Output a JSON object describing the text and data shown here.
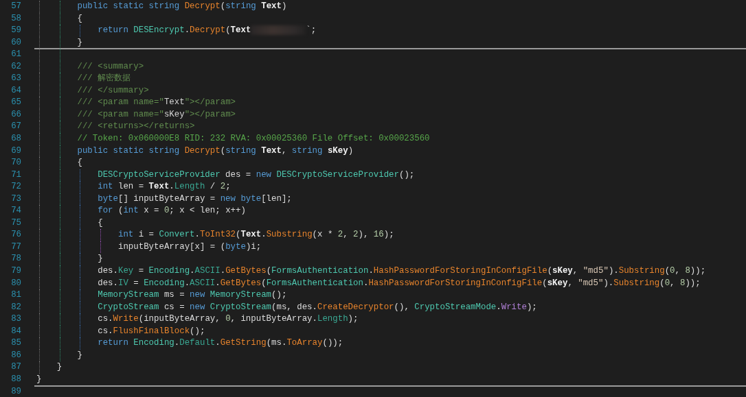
{
  "editor": {
    "lines": [
      {
        "children": [
          {
            "children": [
              {
                "number": "57",
                "separator": false,
                "tokens": [
                  {
                    "kind": "kw",
                    "text": "public static string "
                  },
                  {
                    "kind": "method",
                    "text": "Decrypt"
                  },
                  {
                    "kind": "plain",
                    "text": "("
                  },
                  {
                    "kind": "kw",
                    "text": "string "
                  },
                  {
                    "kind": "param",
                    "text": "Text"
                  },
                  {
                    "kind": "plain",
                    "text": ")"
                  }
                ]
              },
              {
                "number": "58",
                "separator": false,
                "tokens": [
                  {
                    "kind": "plain",
                    "text": "{"
                  }
                ],
                "children": [
                  {
                    "number": "59",
                    "separator": false,
                    "tokens": [
                      {
                        "kind": "kw",
                        "text": "return "
                      },
                      {
                        "kind": "type",
                        "text": "DESEncrypt"
                      },
                      {
                        "kind": "plain",
                        "text": "."
                      },
                      {
                        "kind": "method",
                        "text": "Decrypt"
                      },
                      {
                        "kind": "plain",
                        "text": "("
                      },
                      {
                        "kind": "param",
                        "text": "Text"
                      },
                      {
                        "kind": "redacted"
                      },
                      {
                        "kind": "plain",
                        "text": "`;"
                      }
                    ]
                  }
                ]
              },
              {
                "number": "60",
                "separator": true,
                "tokens": [
                  {
                    "kind": "plain",
                    "text": "}"
                  }
                ]
              },
              {
                "number": "61",
                "separator": false
              },
              {
                "number": "62",
                "separator": false,
                "tokens": [
                  {
                    "kind": "doc",
                    "text": "/// <summary>"
                  }
                ]
              },
              {
                "number": "63",
                "separator": false,
                "tokens": [
                  {
                    "kind": "doc",
                    "text": "/// 解密数据"
                  }
                ]
              },
              {
                "number": "64",
                "separator": false,
                "tokens": [
                  {
                    "kind": "doc",
                    "text": "/// </summary>"
                  }
                ]
              },
              {
                "number": "65",
                "separator": false,
                "tokens": [
                  {
                    "kind": "doc",
                    "text": "/// <param name=\""
                  },
                  {
                    "kind": "docval",
                    "text": "Text"
                  },
                  {
                    "kind": "doc",
                    "text": "\"></param>"
                  }
                ]
              },
              {
                "number": "66",
                "separator": false,
                "tokens": [
                  {
                    "kind": "doc",
                    "text": "/// <param name=\""
                  },
                  {
                    "kind": "docval",
                    "text": "sKey"
                  },
                  {
                    "kind": "doc",
                    "text": "\"></param>"
                  }
                ]
              },
              {
                "number": "67",
                "separator": false,
                "tokens": [
                  {
                    "kind": "doc",
                    "text": "/// <returns></returns>"
                  }
                ]
              },
              {
                "number": "68",
                "separator": false,
                "tokens": [
                  {
                    "kind": "comment",
                    "text": "// Token: 0x060000E8 RID: 232 RVA: 0x00025360 File Offset: 0x00023560"
                  }
                ]
              },
              {
                "number": "69",
                "separator": false,
                "tokens": [
                  {
                    "kind": "kw",
                    "text": "public static string "
                  },
                  {
                    "kind": "method",
                    "text": "Decrypt"
                  },
                  {
                    "kind": "plain",
                    "text": "("
                  },
                  {
                    "kind": "kw",
                    "text": "string "
                  },
                  {
                    "kind": "param",
                    "text": "Text"
                  },
                  {
                    "kind": "plain",
                    "text": ", "
                  },
                  {
                    "kind": "kw",
                    "text": "string "
                  },
                  {
                    "kind": "param",
                    "text": "sKey"
                  },
                  {
                    "kind": "plain",
                    "text": ")"
                  }
                ]
              },
              {
                "number": "70",
                "separator": false,
                "tokens": [
                  {
                    "kind": "plain",
                    "text": "{"
                  }
                ],
                "children": [
                  {
                    "number": "71",
                    "separator": false,
                    "tokens": [
                      {
                        "kind": "type",
                        "text": "DESCryptoServiceProvider"
                      },
                      {
                        "kind": "plain",
                        "text": " des = "
                      },
                      {
                        "kind": "kw",
                        "text": "new "
                      },
                      {
                        "kind": "type",
                        "text": "DESCryptoServiceProvider"
                      },
                      {
                        "kind": "plain",
                        "text": "();"
                      }
                    ]
                  },
                  {
                    "number": "72",
                    "separator": false,
                    "tokens": [
                      {
                        "kind": "kw",
                        "text": "int "
                      },
                      {
                        "kind": "plain",
                        "text": "len = "
                      },
                      {
                        "kind": "param",
                        "text": "Text"
                      },
                      {
                        "kind": "plain",
                        "text": "."
                      },
                      {
                        "kind": "prop",
                        "text": "Length"
                      },
                      {
                        "kind": "plain",
                        "text": " / "
                      },
                      {
                        "kind": "num",
                        "text": "2"
                      },
                      {
                        "kind": "plain",
                        "text": ";"
                      }
                    ]
                  },
                  {
                    "number": "73",
                    "separator": false,
                    "tokens": [
                      {
                        "kind": "kw",
                        "text": "byte"
                      },
                      {
                        "kind": "plain",
                        "text": "[] inputByteArray = "
                      },
                      {
                        "kind": "kw",
                        "text": "new byte"
                      },
                      {
                        "kind": "plain",
                        "text": "[len];"
                      }
                    ]
                  },
                  {
                    "number": "74",
                    "separator": false,
                    "tokens": [
                      {
                        "kind": "kw",
                        "text": "for "
                      },
                      {
                        "kind": "plain",
                        "text": "("
                      },
                      {
                        "kind": "kw",
                        "text": "int "
                      },
                      {
                        "kind": "plain",
                        "text": "x = "
                      },
                      {
                        "kind": "num",
                        "text": "0"
                      },
                      {
                        "kind": "plain",
                        "text": "; x < len; x++)"
                      }
                    ]
                  },
                  {
                    "number": "75",
                    "separator": false,
                    "tokens": [
                      {
                        "kind": "plain",
                        "text": "{"
                      }
                    ],
                    "children": [
                      {
                        "number": "76",
                        "separator": false,
                        "tokens": [
                          {
                            "kind": "kw",
                            "text": "int "
                          },
                          {
                            "kind": "plain",
                            "text": "i = "
                          },
                          {
                            "kind": "type",
                            "text": "Convert"
                          },
                          {
                            "kind": "plain",
                            "text": "."
                          },
                          {
                            "kind": "method",
                            "text": "ToInt32"
                          },
                          {
                            "kind": "plain",
                            "text": "("
                          },
                          {
                            "kind": "param",
                            "text": "Text"
                          },
                          {
                            "kind": "plain",
                            "text": "."
                          },
                          {
                            "kind": "method",
                            "text": "Substring"
                          },
                          {
                            "kind": "plain",
                            "text": "(x * "
                          },
                          {
                            "kind": "num",
                            "text": "2"
                          },
                          {
                            "kind": "plain",
                            "text": ", "
                          },
                          {
                            "kind": "num",
                            "text": "2"
                          },
                          {
                            "kind": "plain",
                            "text": "), "
                          },
                          {
                            "kind": "num",
                            "text": "16"
                          },
                          {
                            "kind": "plain",
                            "text": ");"
                          }
                        ]
                      },
                      {
                        "number": "77",
                        "separator": false,
                        "tokens": [
                          {
                            "kind": "plain",
                            "text": "inputByteArray[x] = ("
                          },
                          {
                            "kind": "kw",
                            "text": "byte"
                          },
                          {
                            "kind": "plain",
                            "text": ")i;"
                          }
                        ]
                      }
                    ]
                  },
                  {
                    "number": "78",
                    "separator": false,
                    "tokens": [
                      {
                        "kind": "plain",
                        "text": "}"
                      }
                    ]
                  },
                  {
                    "number": "79",
                    "separator": false,
                    "tokens": [
                      {
                        "kind": "plain",
                        "text": "des."
                      },
                      {
                        "kind": "prop",
                        "text": "Key"
                      },
                      {
                        "kind": "plain",
                        "text": " = "
                      },
                      {
                        "kind": "type",
                        "text": "Encoding"
                      },
                      {
                        "kind": "plain",
                        "text": "."
                      },
                      {
                        "kind": "prop",
                        "text": "ASCII"
                      },
                      {
                        "kind": "plain",
                        "text": "."
                      },
                      {
                        "kind": "method",
                        "text": "GetBytes"
                      },
                      {
                        "kind": "plain",
                        "text": "("
                      },
                      {
                        "kind": "type",
                        "text": "FormsAuthentication"
                      },
                      {
                        "kind": "plain",
                        "text": "."
                      },
                      {
                        "kind": "method",
                        "text": "HashPasswordForStoringInConfigFile"
                      },
                      {
                        "kind": "plain",
                        "text": "("
                      },
                      {
                        "kind": "param",
                        "text": "sKey"
                      },
                      {
                        "kind": "plain",
                        "text": ", "
                      },
                      {
                        "kind": "str",
                        "text": "\"md5\""
                      },
                      {
                        "kind": "plain",
                        "text": ")."
                      },
                      {
                        "kind": "method",
                        "text": "Substring"
                      },
                      {
                        "kind": "plain",
                        "text": "("
                      },
                      {
                        "kind": "num",
                        "text": "0"
                      },
                      {
                        "kind": "plain",
                        "text": ", "
                      },
                      {
                        "kind": "num",
                        "text": "8"
                      },
                      {
                        "kind": "plain",
                        "text": "));"
                      }
                    ]
                  },
                  {
                    "number": "80",
                    "separator": false,
                    "tokens": [
                      {
                        "kind": "plain",
                        "text": "des."
                      },
                      {
                        "kind": "prop",
                        "text": "IV"
                      },
                      {
                        "kind": "plain",
                        "text": " = "
                      },
                      {
                        "kind": "type",
                        "text": "Encoding"
                      },
                      {
                        "kind": "plain",
                        "text": "."
                      },
                      {
                        "kind": "prop",
                        "text": "ASCII"
                      },
                      {
                        "kind": "plain",
                        "text": "."
                      },
                      {
                        "kind": "method",
                        "text": "GetBytes"
                      },
                      {
                        "kind": "plain",
                        "text": "("
                      },
                      {
                        "kind": "type",
                        "text": "FormsAuthentication"
                      },
                      {
                        "kind": "plain",
                        "text": "."
                      },
                      {
                        "kind": "method",
                        "text": "HashPasswordForStoringInConfigFile"
                      },
                      {
                        "kind": "plain",
                        "text": "("
                      },
                      {
                        "kind": "param",
                        "text": "sKey"
                      },
                      {
                        "kind": "plain",
                        "text": ", "
                      },
                      {
                        "kind": "str",
                        "text": "\"md5\""
                      },
                      {
                        "kind": "plain",
                        "text": ")."
                      },
                      {
                        "kind": "method",
                        "text": "Substring"
                      },
                      {
                        "kind": "plain",
                        "text": "("
                      },
                      {
                        "kind": "num",
                        "text": "0"
                      },
                      {
                        "kind": "plain",
                        "text": ", "
                      },
                      {
                        "kind": "num",
                        "text": "8"
                      },
                      {
                        "kind": "plain",
                        "text": "));"
                      }
                    ]
                  },
                  {
                    "number": "81",
                    "separator": false,
                    "tokens": [
                      {
                        "kind": "type",
                        "text": "MemoryStream"
                      },
                      {
                        "kind": "plain",
                        "text": " ms = "
                      },
                      {
                        "kind": "kw",
                        "text": "new "
                      },
                      {
                        "kind": "type",
                        "text": "MemoryStream"
                      },
                      {
                        "kind": "plain",
                        "text": "();"
                      }
                    ]
                  },
                  {
                    "number": "82",
                    "separator": false,
                    "tokens": [
                      {
                        "kind": "type",
                        "text": "CryptoStream"
                      },
                      {
                        "kind": "plain",
                        "text": " cs = "
                      },
                      {
                        "kind": "kw",
                        "text": "new "
                      },
                      {
                        "kind": "type",
                        "text": "CryptoStream"
                      },
                      {
                        "kind": "plain",
                        "text": "(ms, des."
                      },
                      {
                        "kind": "method",
                        "text": "CreateDecryptor"
                      },
                      {
                        "kind": "plain",
                        "text": "(), "
                      },
                      {
                        "kind": "type",
                        "text": "CryptoStreamMode"
                      },
                      {
                        "kind": "plain",
                        "text": "."
                      },
                      {
                        "kind": "enum",
                        "text": "Write"
                      },
                      {
                        "kind": "plain",
                        "text": ");"
                      }
                    ]
                  },
                  {
                    "number": "83",
                    "separator": false,
                    "tokens": [
                      {
                        "kind": "plain",
                        "text": "cs."
                      },
                      {
                        "kind": "method",
                        "text": "Write"
                      },
                      {
                        "kind": "plain",
                        "text": "(inputByteArray, "
                      },
                      {
                        "kind": "num",
                        "text": "0"
                      },
                      {
                        "kind": "plain",
                        "text": ", inputByteArray."
                      },
                      {
                        "kind": "prop",
                        "text": "Length"
                      },
                      {
                        "kind": "plain",
                        "text": ");"
                      }
                    ]
                  },
                  {
                    "number": "84",
                    "separator": false,
                    "tokens": [
                      {
                        "kind": "plain",
                        "text": "cs."
                      },
                      {
                        "kind": "method",
                        "text": "FlushFinalBlock"
                      },
                      {
                        "kind": "plain",
                        "text": "();"
                      }
                    ]
                  },
                  {
                    "number": "85",
                    "separator": false,
                    "tokens": [
                      {
                        "kind": "kw",
                        "text": "return "
                      },
                      {
                        "kind": "type",
                        "text": "Encoding"
                      },
                      {
                        "kind": "plain",
                        "text": "."
                      },
                      {
                        "kind": "prop",
                        "text": "Default"
                      },
                      {
                        "kind": "plain",
                        "text": "."
                      },
                      {
                        "kind": "method",
                        "text": "GetString"
                      },
                      {
                        "kind": "plain",
                        "text": "(ms."
                      },
                      {
                        "kind": "method",
                        "text": "ToArray"
                      },
                      {
                        "kind": "plain",
                        "text": "());"
                      }
                    ]
                  }
                ]
              },
              {
                "number": "86",
                "separator": false,
                "tokens": [
                  {
                    "kind": "plain",
                    "text": "}"
                  }
                ]
              }
            ]
          },
          {
            "number": "87",
            "separator": false,
            "tokens": [
              {
                "kind": "plain",
                "text": "}"
              }
            ]
          }
        ]
      },
      {
        "number": "88",
        "separator": true,
        "tokens": [
          {
            "kind": "plain",
            "text": "}"
          }
        ]
      },
      {
        "number": "89",
        "separator": false
      }
    ]
  }
}
